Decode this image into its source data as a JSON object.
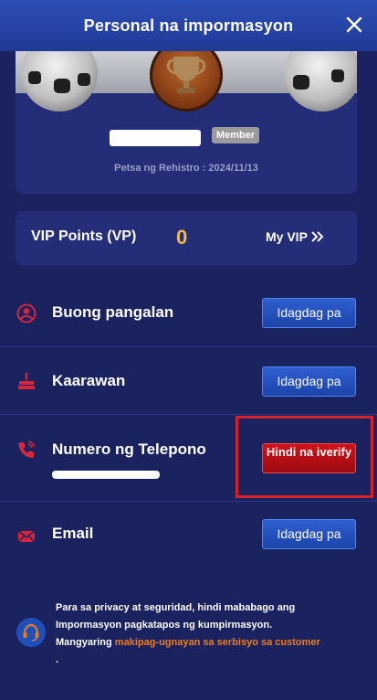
{
  "header": {
    "title": "Personal na impormasyon",
    "close_icon": "close-icon"
  },
  "profile": {
    "badge": "Member",
    "registration_date": "Petsa ng Rehistro : 2024/11/13"
  },
  "vip": {
    "label": "VIP Points (VP)",
    "value": "0",
    "my_vip_label": "My VIP",
    "value_color": "#f5b843"
  },
  "fields": [
    {
      "icon": "user-circle-icon",
      "label": "Buong pangalan",
      "action": "Idagdag pa"
    },
    {
      "icon": "cake-icon",
      "label": "Kaarawan",
      "action": "Idagdag pa"
    },
    {
      "icon": "phone-icon",
      "label": "Numero ng Telepono",
      "action": "Hindi na iverify"
    },
    {
      "icon": "mail-icon",
      "label": "Email",
      "action": "Idagdag pa"
    }
  ],
  "privacy": {
    "text_before": "Para sa privacy at seguridad, hindi mababago ang Impormasyon pagkatapos ng kumpirmasyon. Mangyaring ",
    "link": "makipag-ugnayan sa serbisyo sa customer",
    "text_after": " .",
    "icon": "headset-icon"
  },
  "colors": {
    "background": "#1b2260",
    "header": "#2d4fb8",
    "button_blue": "#2f5fd0",
    "button_red": "#d0131a",
    "link": "#f07c17",
    "icon_red": "#d7263a"
  }
}
